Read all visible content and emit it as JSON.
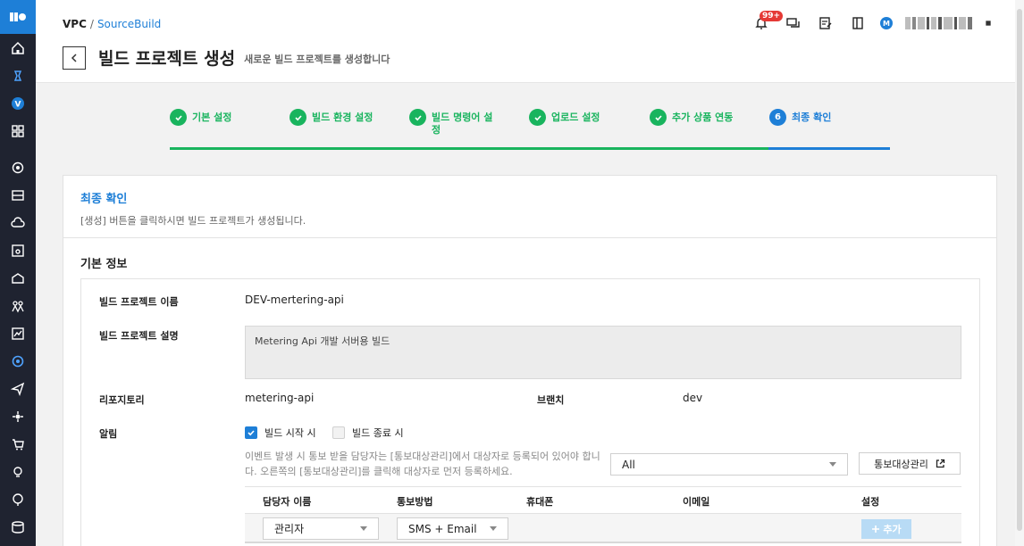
{
  "breadcrumb": {
    "root": "VPC",
    "separator": "/",
    "current": "SourceBuild"
  },
  "page": {
    "title": "빌드 프로젝트 생성",
    "subtitle": "새로운 빌드 프로젝트를 생성합니다"
  },
  "header": {
    "notification_badge": "99+",
    "user_initial": "M"
  },
  "rail": {
    "icons": [
      "logo-icon",
      "home-icon",
      "pin-icon",
      "vpc-icon",
      "apps-icon",
      "network-icon",
      "storage-icon",
      "cloud-icon",
      "server-icon",
      "database-icon",
      "group-icon",
      "report-icon",
      "sourcebuild-icon",
      "send-icon",
      "flow-icon",
      "cart-icon",
      "bulb-icon",
      "globe-icon",
      "disk-icon"
    ]
  },
  "steps": [
    {
      "label": "기본 설정",
      "status": "done"
    },
    {
      "label": "빌드 환경 설정",
      "status": "done"
    },
    {
      "label": "빌드 명령어 설정",
      "status": "done"
    },
    {
      "label": "업로드 설정",
      "status": "done"
    },
    {
      "label": "추가 상품 연동",
      "status": "done"
    },
    {
      "label": "최종 확인",
      "status": "active",
      "number": "6"
    }
  ],
  "card": {
    "title": "최종 확인",
    "description": "[생성] 버튼을 클릭하시면 빌드 프로젝트가 생성됩니다.",
    "section_title": "기본 정보"
  },
  "info": {
    "project_name_label": "빌드 프로젝트 이름",
    "project_name": "DEV-mertering-api",
    "project_desc_label": "빌드 프로젝트 설명",
    "project_desc": "Metering Api 개발 서버용 빌드",
    "repo_label": "리포지토리",
    "repo": "metering-api",
    "branch_label": "브랜치",
    "branch": "dev",
    "notify_label": "알림",
    "notify_start": "빌드 시작 시",
    "notify_start_checked": true,
    "notify_end": "빌드 종료 시",
    "notify_end_checked": false,
    "notify_help": "이벤트 발생 시 통보 받을 담당자는 [통보대상관리]에서 대상자로 등록되어 있어야 합니다. 오른쪽의 [통보대상관리]를 클릭해 대상자로 먼저 등록하세요.",
    "target_filter": "All",
    "target_manage_button": "통보대상관리"
  },
  "table": {
    "headers": [
      "담당자 이름",
      "통보방법",
      "휴대폰",
      "이메일",
      "설정"
    ],
    "row": {
      "name_select": "관리자",
      "method_select": "SMS + Email",
      "add_button": "추가"
    }
  }
}
